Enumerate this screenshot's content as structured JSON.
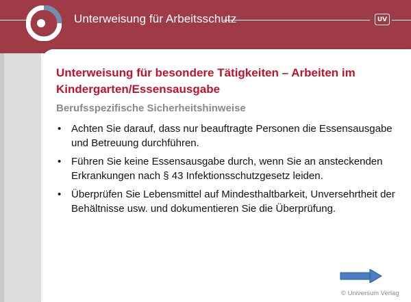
{
  "header": {
    "title": "Unterweisung für Arbeitsschutz",
    "badge": "UV",
    "brand_color": "#9e3b46"
  },
  "slide": {
    "title": "Unterweisung für besondere Tätigkeiten – Arbeiten im Kindergarten/Essensausgabe",
    "title_color": "#c0132a",
    "subtitle": "Berufsspezifische Sicherheitshinweise",
    "bullet_glyph": "•",
    "bullets": [
      "Achten Sie darauf, dass nur beauftragte Personen die Essensausgabe und Betreuung durchführen.",
      "Führen Sie keine Essensausgabe durch, wenn Sie an ansteckenden Erkrankungen nach § 43 Infektionsschutzgesetz leiden.",
      "Überprüfen Sie Lebensmittel auf Mindesthaltbarkeit, Unversehrtheit der Behältnisse usw. und dokumentieren Sie die Überprüfung."
    ]
  },
  "navigation": {
    "next_icon": "right-arrow-icon",
    "arrow_color": "#4a7fc1"
  },
  "footer": {
    "copyright": "© Universum Verlag"
  }
}
